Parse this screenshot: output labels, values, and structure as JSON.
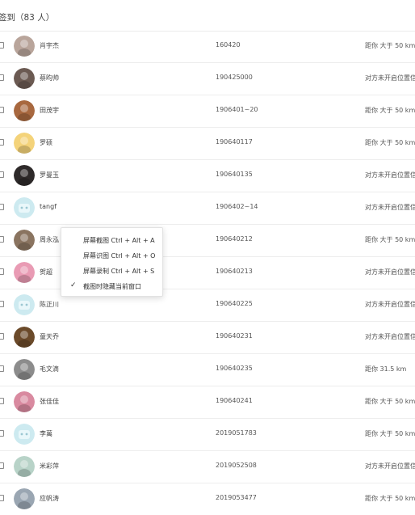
{
  "header": {
    "title": "签到（83 人）"
  },
  "rows": [
    {
      "name": "肖宇杰",
      "sid": "160420",
      "dist": "距你 大于 50 km",
      "avatar_color": "#b9a59b"
    },
    {
      "name": "蔡昀帅",
      "sid": "190425000",
      "dist": "对方未开启位置信",
      "avatar_color": "#6b5a52"
    },
    {
      "name": "田茂宇",
      "sid": "1906401~20",
      "dist": "距你 大于 50 km",
      "avatar_color": "#a8683f"
    },
    {
      "name": "罗硕",
      "sid": "190640117",
      "dist": "距你 大于 50 km",
      "avatar_color": "#f4d37a"
    },
    {
      "name": "罗曼玉",
      "sid": "190640135",
      "dist": "对方未开启位置信",
      "avatar_color": "#2e2a2a"
    },
    {
      "name": "tangf",
      "sid": "1906402~14",
      "dist": "对方未开启位置信",
      "avatar_color": "#bfe6ec"
    },
    {
      "name": "周永泓",
      "sid": "190640212",
      "dist": "距你 大于 50 km",
      "avatar_color": "#8a7460"
    },
    {
      "name": "贺超",
      "sid": "190640213",
      "dist": "对方未开启位置信",
      "avatar_color": "#e99bb4"
    },
    {
      "name": "陈正川",
      "sid": "190640225",
      "dist": "对方未开启位置信",
      "avatar_color": "#bfe6ec"
    },
    {
      "name": "童天乔",
      "sid": "190640231",
      "dist": "对方未开启位置信",
      "avatar_color": "#6b4a2a"
    },
    {
      "name": "毛文滴",
      "sid": "190640235",
      "dist": "距你 31.5 km",
      "avatar_color": "#8c8c8c"
    },
    {
      "name": "张佳佳",
      "sid": "190640241",
      "dist": "距你 大于 50 km",
      "avatar_color": "#d98aa0"
    },
    {
      "name": "李萬",
      "sid": "2019051783",
      "dist": "距你 大于 50 km",
      "avatar_color": "#bfe6ec"
    },
    {
      "name": "米彩萍",
      "sid": "2019052508",
      "dist": "对方未开启位置信",
      "avatar_color": "#b8d3c8"
    },
    {
      "name": "应帆涛",
      "sid": "2019053477",
      "dist": "距你 大于 50 km",
      "avatar_color": "#9aa6b2"
    }
  ],
  "context_menu": {
    "items": [
      {
        "label": "屏幕截图 Ctrl + Alt + A",
        "checked": false
      },
      {
        "label": "屏幕识图 Ctrl + Alt + O",
        "checked": false
      },
      {
        "label": "屏幕录制 Ctrl + Alt + S",
        "checked": false
      },
      {
        "label": "截图时隐藏当前窗口",
        "checked": true
      }
    ],
    "check_glyph": "✓"
  }
}
